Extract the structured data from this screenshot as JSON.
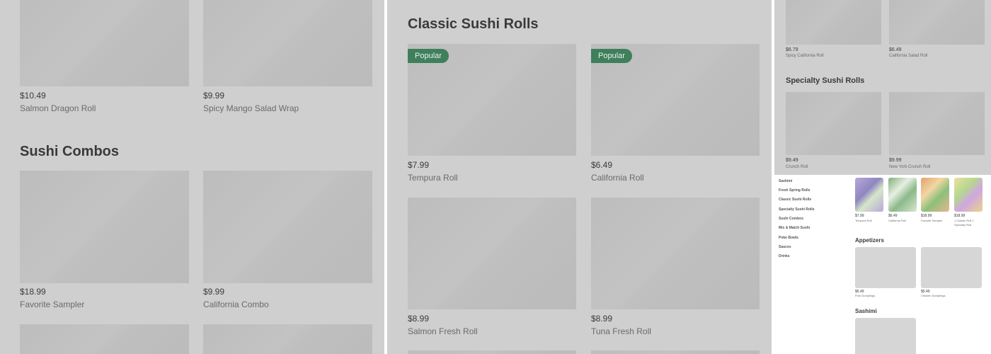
{
  "panelA": {
    "top_items": [
      {
        "price": "$10.49",
        "name": "Salmon Dragon Roll"
      },
      {
        "price": "$9.99",
        "name": "Spicy Mango Salad Wrap"
      }
    ],
    "section_title": "Sushi Combos",
    "combo_items": [
      {
        "price": "$18.99",
        "name": "Favorite Sampler"
      },
      {
        "price": "$9.99",
        "name": "California Combo"
      }
    ]
  },
  "panelB": {
    "section_title": "Classic Sushi Rolls",
    "badge_label": "Popular",
    "items": [
      {
        "price": "$7.99",
        "name": "Tempura Roll"
      },
      {
        "price": "$6.49",
        "name": "California Roll"
      },
      {
        "price": "$8.99",
        "name": "Salmon Fresh Roll"
      },
      {
        "price": "$8.99",
        "name": "Tuna Fresh Roll"
      }
    ]
  },
  "panelC": {
    "top_items": [
      {
        "price": "$6.79",
        "name": "Spicy California Roll"
      },
      {
        "price": "$6.49",
        "name": "California Salad Roll"
      }
    ],
    "section_title": "Specialty Sushi Rolls",
    "items": [
      {
        "price": "$9.49",
        "name": "Crunch Roll"
      },
      {
        "price": "$9.99",
        "name": "New York Crunch Roll"
      }
    ]
  },
  "panelD": {
    "nav": [
      "Sashimi",
      "Fresh Spring Rolls",
      "Classic Sushi Rolls",
      "Specialty Sushi Rolls",
      "Sushi Combos",
      "Mix & Match Sushi",
      "Poke Bowls",
      "Sauces",
      "Drinks"
    ],
    "top_items": [
      {
        "price": "$7.99",
        "name": "Tempura Roll"
      },
      {
        "price": "$6.49",
        "name": "California Roll"
      },
      {
        "price": "$18.99",
        "name": "Favorite Sampler"
      },
      {
        "price": "$18.99",
        "name": "1 Classic Roll 1 Specialty Roll"
      }
    ],
    "appetizers_title": "Appetizers",
    "appetizers": [
      {
        "price": "$5.49",
        "name": "Pork Dumplings"
      },
      {
        "price": "$5.49",
        "name": "Chicken Dumplings"
      }
    ],
    "sashimi_title": "Sashimi"
  },
  "colors": {
    "badge": "#3f7f5c",
    "overlay": "#cfcfcf"
  }
}
